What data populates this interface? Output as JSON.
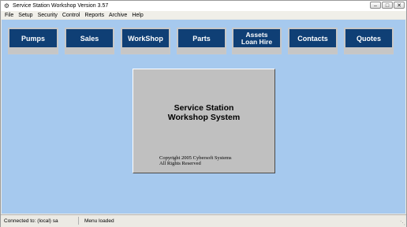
{
  "window": {
    "title": "Service Station Workshop Version 3.57",
    "controls": {
      "minimize": "–",
      "maximize": "□",
      "close": "✕"
    }
  },
  "menu": [
    "File",
    "Setup",
    "Security",
    "Control",
    "Reports",
    "Archive",
    "Help"
  ],
  "nav_buttons": [
    {
      "label": "Pumps"
    },
    {
      "label": "Sales"
    },
    {
      "label": "WorkShop"
    },
    {
      "label": "Parts"
    },
    {
      "label": "Assets\nLoan Hire"
    },
    {
      "label": "Contacts"
    },
    {
      "label": "Quotes"
    }
  ],
  "splash": {
    "title_line1": "Service Station",
    "title_line2": "Workshop System",
    "copyright_line1": "Copyright 2005 Cybersoft Systems",
    "copyright_line2": "All Rights Reserved"
  },
  "status": {
    "connection": "Connected to: (local) sa",
    "message": "Menu loaded"
  },
  "colors": {
    "workspace": "#a6c9ee",
    "nav_button_face": "#0f3f75",
    "splash_bg": "#c0c0c0"
  }
}
